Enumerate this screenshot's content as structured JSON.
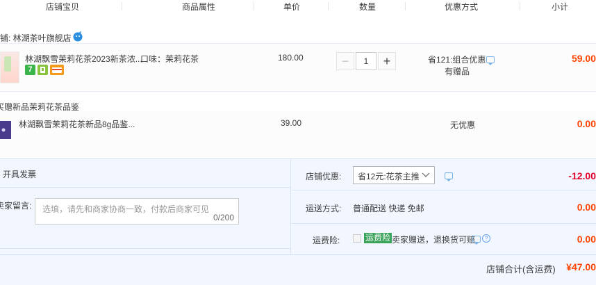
{
  "header": {
    "col_item": "店铺宝贝",
    "col_attr": "商品属性",
    "col_price": "单价",
    "col_qty": "数量",
    "col_promo": "优惠方式",
    "col_subtotal": "小计"
  },
  "shop": {
    "name": "店铺: 林湖茶叶旗舰店",
    "icon": "wangwang-chat-icon"
  },
  "item": {
    "title": "林湖飘雪茉莉花茶2023新茶浓...",
    "attr": "口味：茉莉花茶",
    "price": "180.00",
    "qty": "1",
    "promo_line1": "省121:组合优惠",
    "promo_line2": "有赠品",
    "subtotal": "59.00",
    "badges": [
      {
        "text": "7",
        "color": "#3bb54a"
      },
      {
        "text": "",
        "color": "#89c43f"
      },
      {
        "text": "",
        "color": "#f59b1a"
      }
    ]
  },
  "gift": {
    "header": "买赠新品茉莉花茶品鉴",
    "title": "林湖飘雪茉莉花茶新品8g品鉴...",
    "price": "39.00",
    "promo": "无优惠",
    "subtotal": "0.00"
  },
  "footer": {
    "invoice_label": "开具发票",
    "message_label": "卖家留言:",
    "message_placeholder": "选填，请先和商家协商一致，付款后商家可见",
    "message_count": "0/200",
    "shop_discount_label": "店铺优惠:",
    "shop_discount_select": "省12元:花茶主推",
    "shop_discount_amount": "-12.00",
    "shipping_label": "运送方式:",
    "shipping_value": "普通配送 快递 免邮",
    "shipping_amount": "0.00",
    "insurance_label": "运费险:",
    "insurance_badge": "运费险",
    "insurance_text": "卖家赠送，退换货可赔",
    "insurance_amount": "0.00",
    "total_label": "店铺合计(含运费)",
    "total_value": "¥47.00"
  },
  "colors": {
    "price_red": "#ff4400",
    "discount_red": "#e4002b",
    "footer_bg": "#f2f7ff",
    "link_blue": "#6aa3e6"
  }
}
